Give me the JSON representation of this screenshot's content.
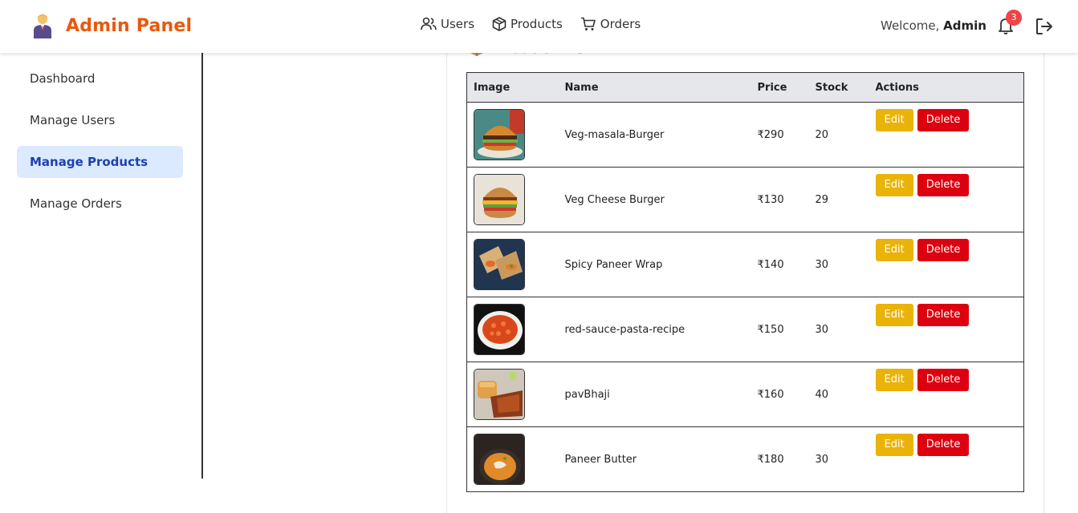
{
  "header": {
    "title": "Admin Panel",
    "nav": [
      {
        "label": "Users",
        "icon": "users-icon"
      },
      {
        "label": "Products",
        "icon": "box-icon"
      },
      {
        "label": "Orders",
        "icon": "cart-icon"
      }
    ],
    "welcome_prefix": "Welcome,",
    "welcome_name": "Admin",
    "notification_count": "3"
  },
  "sidebar": {
    "items": [
      {
        "label": "Dashboard"
      },
      {
        "label": "Manage Users"
      },
      {
        "label": "Manage Products",
        "active": true
      },
      {
        "label": "Manage Orders"
      }
    ]
  },
  "products": {
    "title": "Product List",
    "columns": [
      "Image",
      "Name",
      "Price",
      "Stock",
      "Actions"
    ],
    "edit_label": "Edit",
    "delete_label": "Delete",
    "rows": [
      {
        "name": "Veg-masala-Burger",
        "price": "₹290",
        "stock": "20"
      },
      {
        "name": "Veg Cheese Burger",
        "price": "₹130",
        "stock": "29"
      },
      {
        "name": "Spicy Paneer Wrap",
        "price": "₹140",
        "stock": "30"
      },
      {
        "name": "red-sauce-pasta-recipe",
        "price": "₹150",
        "stock": "30"
      },
      {
        "name": "pavBhaji",
        "price": "₹160",
        "stock": "40"
      },
      {
        "name": "Paneer Butter",
        "price": "₹180",
        "stock": "30"
      }
    ]
  },
  "colors": {
    "brand": "#ea580c",
    "active_bg": "#dbeafe",
    "active_text": "#1e40af",
    "edit": "#eab308",
    "delete": "#dc0010",
    "badge": "#ef4444"
  }
}
